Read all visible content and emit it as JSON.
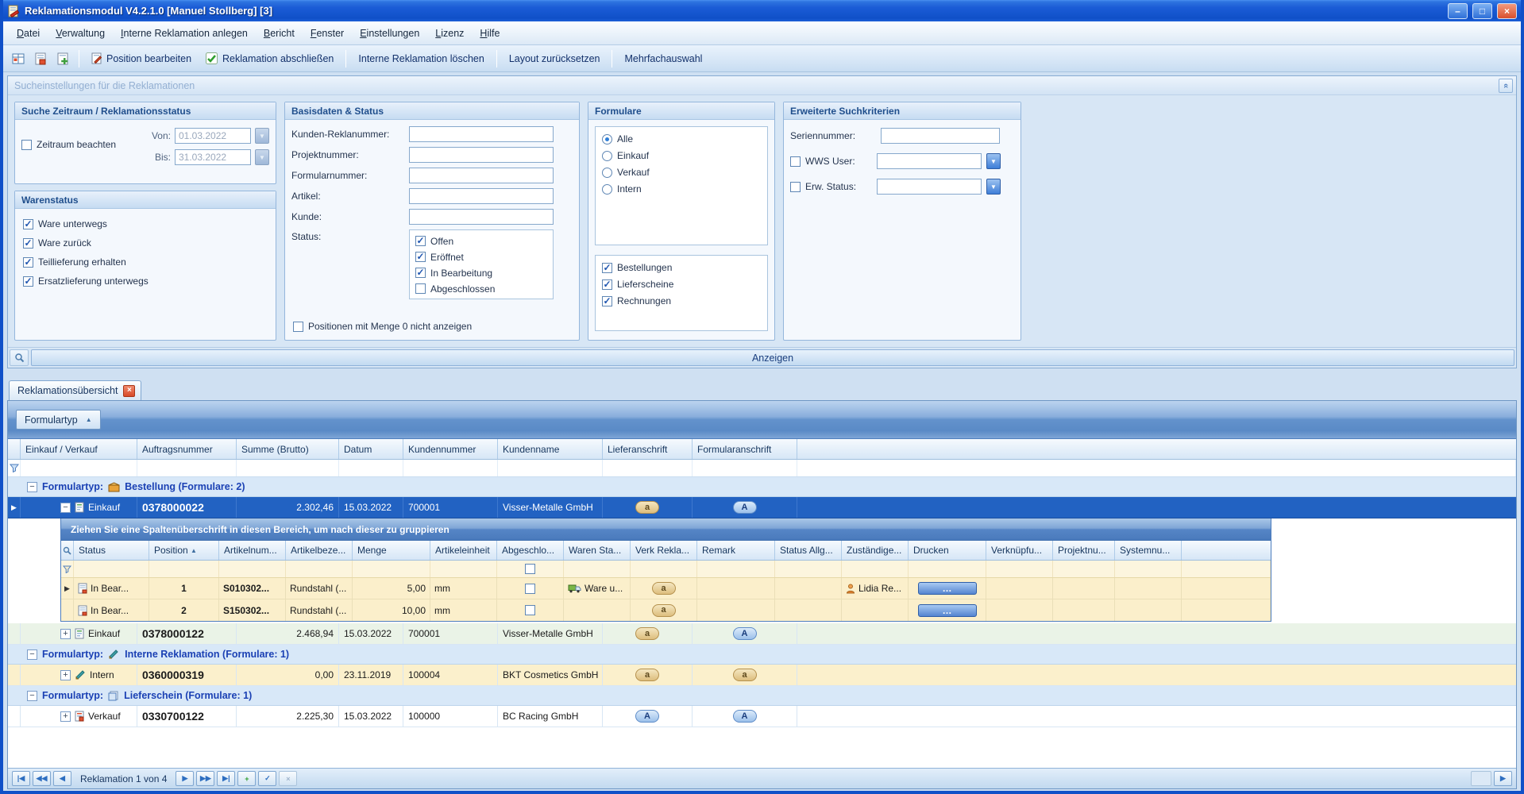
{
  "window": {
    "title": "Reklamationsmodul V4.2.1.0 [Manuel Stollberg] [3]"
  },
  "colors": {
    "titlebar_blue": "#1557CE",
    "selection_bg": "#2262C2",
    "group_text": "#1B41B4",
    "detail_row_bg": "#FBEFCB",
    "panel_bg": "#D7E6F5"
  },
  "icons": {
    "minimize": "–",
    "maximize": "□",
    "close": "×",
    "dropdown": "▼",
    "sort_asc": "▲",
    "collapse": "−",
    "expand": "+",
    "row_indicator": "▶",
    "tab_close": "×",
    "ellipsis": "…",
    "panel_collapse": "«",
    "nav_first": "|◀",
    "nav_prev_page": "◀◀",
    "nav_prev": "◀",
    "nav_next": "▶",
    "nav_next_page": "▶▶",
    "nav_last": "▶|",
    "nav_add": "+",
    "nav_commit": "✓",
    "nav_cancel": "×",
    "scroll_right": "▶"
  },
  "menu": {
    "items": [
      {
        "label": "Datei"
      },
      {
        "label": "Verwaltung"
      },
      {
        "label": "Interne Reklamation anlegen"
      },
      {
        "label": "Bericht"
      },
      {
        "label": "Fenster"
      },
      {
        "label": "Einstellungen"
      },
      {
        "label": "Lizenz"
      },
      {
        "label": "Hilfe"
      }
    ]
  },
  "toolbar": {
    "buttons": [
      {
        "label": "Position bearbeiten"
      },
      {
        "label": "Reklamation abschließen"
      },
      {
        "label": "Interne Reklamation löschen"
      },
      {
        "label": "Layout zurücksetzen"
      },
      {
        "label": "Mehrfachauswahl"
      }
    ]
  },
  "search": {
    "caption": "Sucheinstellungen für die Reklamationen",
    "period": {
      "title": "Suche Zeitraum / Reklamationsstatus",
      "checkbox_label": "Zeitraum beachten",
      "checkbox_checked": false,
      "von_label": "Von:",
      "von_value": "01.03.2022",
      "bis_label": "Bis:",
      "bis_value": "31.03.2022"
    },
    "warenstatus": {
      "title": "Warenstatus",
      "items": [
        {
          "label": "Ware unterwegs",
          "checked": true
        },
        {
          "label": "Ware zurück",
          "checked": true
        },
        {
          "label": "Teillieferung erhalten",
          "checked": true
        },
        {
          "label": "Ersatzlieferung unterwegs",
          "checked": true
        }
      ]
    },
    "basisdaten": {
      "title": "Basisdaten & Status",
      "fields": [
        {
          "label": "Kunden-Reklanummer:",
          "value": ""
        },
        {
          "label": "Projektnummer:",
          "value": ""
        },
        {
          "label": "Formularnummer:",
          "value": ""
        },
        {
          "label": "Artikel:",
          "value": ""
        },
        {
          "label": "Kunde:",
          "value": ""
        }
      ],
      "status_label": "Status:",
      "status_items": [
        {
          "label": "Offen",
          "checked": true
        },
        {
          "label": "Eröffnet",
          "checked": true
        },
        {
          "label": "In Bearbeitung",
          "checked": true
        },
        {
          "label": "Abgeschlossen",
          "checked": false
        }
      ],
      "menge_checkbox": {
        "label": "Positionen mit Menge 0 nicht anzeigen",
        "checked": false
      }
    },
    "formulare": {
      "title": "Formulare",
      "radios": [
        {
          "label": "Alle",
          "selected": true
        },
        {
          "label": "Einkauf",
          "selected": false
        },
        {
          "label": "Verkauf",
          "selected": false
        },
        {
          "label": "Intern",
          "selected": false
        }
      ],
      "checks": [
        {
          "label": "Bestellungen",
          "checked": true
        },
        {
          "label": "Lieferscheine",
          "checked": true
        },
        {
          "label": "Rechnungen",
          "checked": true
        }
      ]
    },
    "erweitert": {
      "title": "Erweiterte Suchkriterien",
      "serien_label": "Seriennummer:",
      "serien_value": "",
      "wws": {
        "label": "WWS User:",
        "checked": false,
        "value": ""
      },
      "erw": {
        "label": "Erw. Status:",
        "checked": false,
        "value": ""
      }
    },
    "anzeigen_label": "Anzeigen"
  },
  "tabs": {
    "active": "Reklamationsübersicht"
  },
  "grid": {
    "group_chip": "Formulartyp",
    "columns": [
      "Einkauf / Verkauf",
      "Auftragsnummer",
      "Summe (Brutto)",
      "Datum",
      "Kundennummer",
      "Kundenname",
      "Lieferanschrift",
      "Formularanschrift"
    ],
    "groups": [
      {
        "label": "Formulartyp:",
        "value": "Bestellung (Formulare: 2)"
      },
      {
        "label": "Formulartyp:",
        "value": "Interne Reklamation (Formulare: 1)"
      },
      {
        "label": "Formulartyp:",
        "value": "Lieferschein (Formulare: 1)"
      }
    ],
    "rows": [
      {
        "typ": "Einkauf",
        "auftragsnummer": "0378000022",
        "summe": "2.302,46",
        "datum": "15.03.2022",
        "kundennummer": "700001",
        "kundenname": "Visser-Metalle GmbH",
        "lieferanschrift_btn": "a",
        "formularanschrift_btn": "A"
      },
      {
        "typ": "Einkauf",
        "auftragsnummer": "0378000122",
        "summe": "2.468,94",
        "datum": "15.03.2022",
        "kundennummer": "700001",
        "kundenname": "Visser-Metalle GmbH",
        "lieferanschrift_btn": "a",
        "formularanschrift_btn": "A"
      },
      {
        "typ": "Intern",
        "auftragsnummer": "0360000319",
        "summe": "0,00",
        "datum": "23.11.2019",
        "kundennummer": "100004",
        "kundenname": "BKT Cosmetics GmbH",
        "lieferanschrift_btn": "a",
        "formularanschrift_btn": "a"
      },
      {
        "typ": "Verkauf",
        "auftragsnummer": "0330700122",
        "summe": "2.225,30",
        "datum": "15.03.2022",
        "kundennummer": "100000",
        "kundenname": "BC Racing GmbH",
        "lieferanschrift_btn": "A",
        "formularanschrift_btn": "A"
      }
    ]
  },
  "detail": {
    "group_hint": "Ziehen Sie eine Spaltenüberschrift in diesen Bereich, um nach dieser zu gruppieren",
    "columns": [
      "Status",
      "Position",
      "Artikelnum...",
      "Artikelbeze...",
      "Menge",
      "Artikeleinheit",
      "Abgeschlo...",
      "Waren Sta...",
      "Verk Rekla...",
      "Remark",
      "Status Allg...",
      "Zuständige...",
      "Drucken",
      "Verknüpfu...",
      "Projektnu...",
      "Systemnu..."
    ],
    "rows": [
      {
        "status": "In Bear...",
        "position": "1",
        "artikelnummer": "S010302...",
        "artikelbezeichnung": "Rundstahl (...",
        "menge": "5,00",
        "einheit": "mm",
        "abgeschlossen": false,
        "warenstatus": "Ware u...",
        "verk_btn": "a",
        "remark": "",
        "status_allg": "",
        "zustaendige": "Lidia Re...",
        "verknuepfung": "",
        "projektnummer": "",
        "systemnummer": ""
      },
      {
        "status": "In Bear...",
        "position": "2",
        "artikelnummer": "S150302...",
        "artikelbezeichnung": "Rundstahl (...",
        "menge": "10,00",
        "einheit": "mm",
        "abgeschlossen": false,
        "warenstatus": "",
        "verk_btn": "a",
        "remark": "",
        "status_allg": "",
        "zustaendige": "",
        "verknuepfung": "",
        "projektnummer": "",
        "systemnummer": ""
      }
    ]
  },
  "navigator": {
    "label": "Reklamation 1 von 4"
  }
}
